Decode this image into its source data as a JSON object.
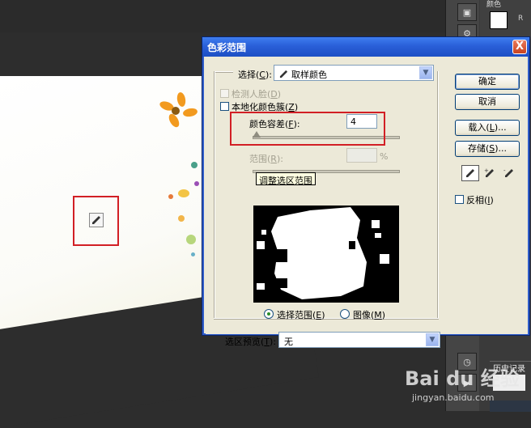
{
  "dialog": {
    "title": "色彩范围",
    "close_glyph": "X",
    "select_label": "选择(",
    "select_key": "C",
    "select_suffix": "):",
    "select_value": "取样颜色",
    "detect_faces_label": "检测人脸(",
    "detect_faces_key": "D",
    "detect_faces_suffix": ")",
    "localized_clusters_label": "本地化颜色簇(",
    "localized_clusters_key": "Z",
    "localized_clusters_suffix": ")",
    "fuzziness_label": "颜色容差(",
    "fuzziness_key": "F",
    "fuzziness_suffix": "):",
    "fuzziness_value": "4",
    "range_label": "范围(",
    "range_key": "R",
    "range_suffix": "):",
    "range_unit": "%",
    "tooltip": "调整选区范围",
    "radio_selection_label": "选择范围(",
    "radio_selection_key": "E",
    "radio_selection_suffix": ")",
    "radio_image_label": "图像(",
    "radio_image_key": "M",
    "radio_image_suffix": ")",
    "preview_label": "选区预览(",
    "preview_key": "T",
    "preview_suffix": "):",
    "preview_value": "无",
    "ok_label": "确定",
    "cancel_label": "取消",
    "load_label": "载入(",
    "load_key": "L",
    "load_suffix": ")...",
    "save_label": "存储(",
    "save_key": "S",
    "save_suffix": ")...",
    "invert_label": "反相(",
    "invert_key": "I",
    "invert_suffix": ")"
  },
  "side_panels": {
    "tab_label": "颜色",
    "r_label": "R",
    "history_label": "历史记录"
  },
  "watermark": {
    "brand": "Bai du 经验",
    "site": "jingyan.baidu.com"
  },
  "colors": {
    "title_blue": "#2a5fd8",
    "highlight_red": "#d21f25",
    "dialog_bg": "#ece9d8"
  }
}
